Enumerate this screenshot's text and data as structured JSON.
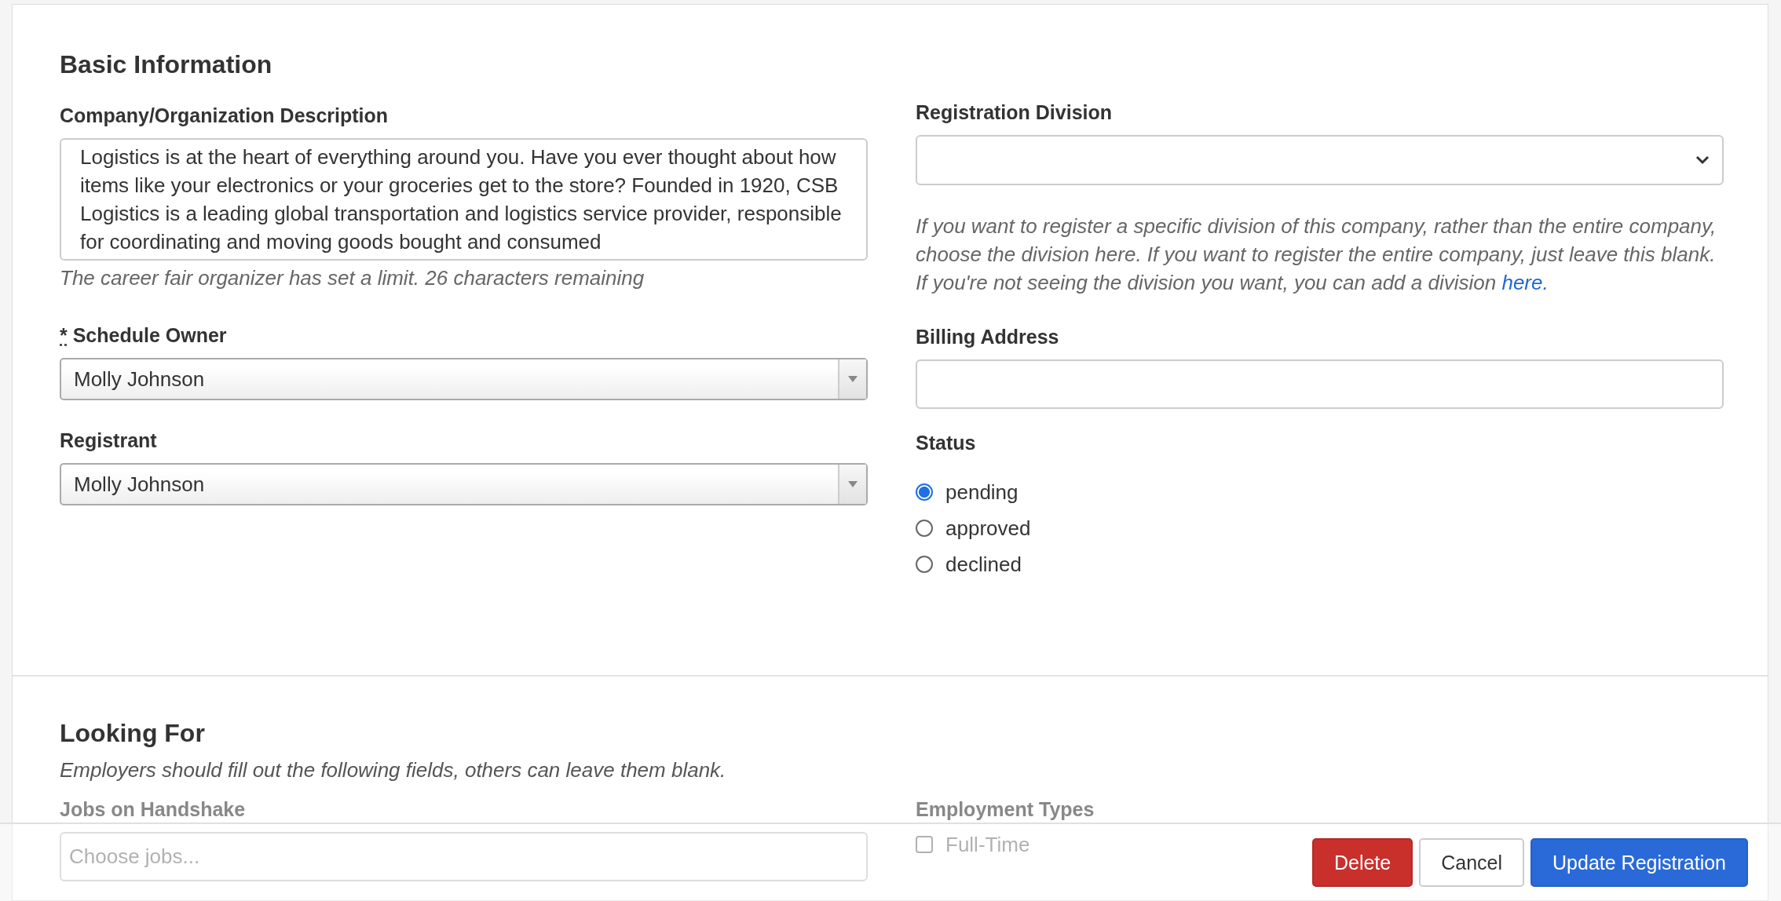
{
  "sections": [
    {
      "title": "Basic Information",
      "left": [
        {
          "kind": "textarea",
          "label": "Company/Organization Description",
          "value": "Logistics is at the heart of everything around you. Have you ever thought about how items like your electronics or your groceries get to the store? Founded in 1920, CSB Logistics is a leading global transportation and logistics service provider, responsible for coordinating and moving goods bought and consumed",
          "hint": "The career fair organizer has set a limit. 26 characters remaining"
        },
        {
          "kind": "combo",
          "label": "Schedule Owner",
          "required_mark": "*",
          "value": "Molly Johnson"
        },
        {
          "kind": "combo",
          "label": "Registrant",
          "value": "Molly Johnson"
        }
      ],
      "right": [
        {
          "kind": "select",
          "label": "Registration Division",
          "notes": [
            {
              "text": "If you want to register a specific division of this company, rather than the entire company, choose the division here. If you want to register the entire company, just leave this blank."
            },
            {
              "text": "If you're not seeing the division you want, you can add a division ",
              "link": "here."
            }
          ]
        },
        {
          "kind": "text",
          "label": "Billing Address"
        },
        {
          "kind": "radios",
          "label": "Status",
          "options": [
            {
              "label": "pending",
              "selected": true
            },
            {
              "label": "approved",
              "selected": false
            },
            {
              "label": "declined",
              "selected": false
            }
          ]
        }
      ]
    },
    {
      "title": "Looking For",
      "intro": "Employers should fill out the following fields, others can leave them blank.",
      "left": [
        {
          "kind": "text",
          "label": "Jobs on Handshake",
          "placeholder": "Choose jobs..."
        }
      ],
      "right": [
        {
          "kind": "checks",
          "label": "Employment Types",
          "options": [
            {
              "label": "Full-Time",
              "checked": false
            }
          ]
        }
      ]
    }
  ],
  "footer": {
    "buttons": [
      {
        "label": "Delete",
        "kind": "danger"
      },
      {
        "label": "Cancel",
        "kind": "default"
      },
      {
        "label": "Update Registration",
        "kind": "primary"
      }
    ]
  }
}
